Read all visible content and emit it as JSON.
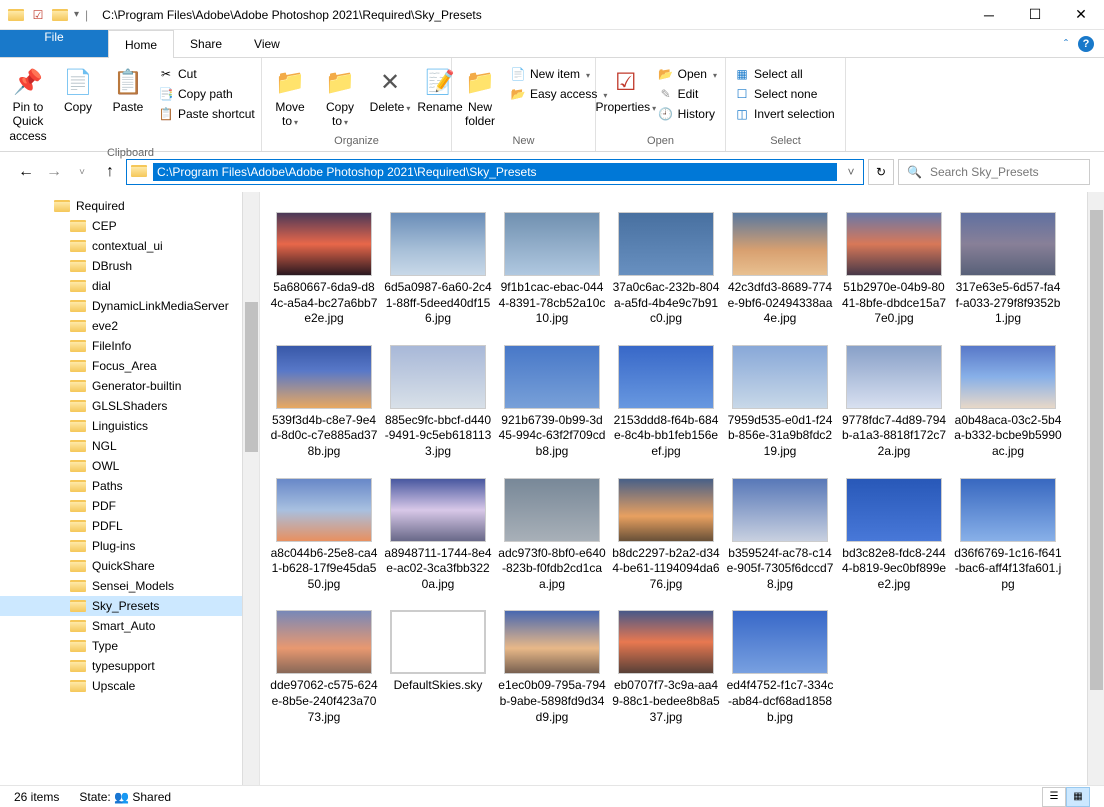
{
  "title": "C:\\Program Files\\Adobe\\Adobe Photoshop 2021\\Required\\Sky_Presets",
  "address_path": "C:\\Program Files\\Adobe\\Adobe Photoshop 2021\\Required\\Sky_Presets",
  "search_placeholder": "Search Sky_Presets",
  "tabs": {
    "file": "File",
    "home": "Home",
    "share": "Share",
    "view": "View"
  },
  "ribbon": {
    "pin": "Pin to Quick access",
    "copy": "Copy",
    "paste": "Paste",
    "cut": "Cut",
    "copypath": "Copy path",
    "pasteshortcut": "Paste shortcut",
    "clipboard": "Clipboard",
    "moveto": "Move to",
    "copyto": "Copy to",
    "delete": "Delete",
    "rename": "Rename",
    "organize": "Organize",
    "newfolder": "New folder",
    "newitem": "New item",
    "easyaccess": "Easy access",
    "new": "New",
    "properties": "Properties",
    "open": "Open",
    "edit": "Edit",
    "history": "History",
    "open_group": "Open",
    "selectall": "Select all",
    "selectnone": "Select none",
    "invert": "Invert selection",
    "select": "Select"
  },
  "tree": {
    "root": "Required",
    "items": [
      "CEP",
      "contextual_ui",
      "DBrush",
      "dial",
      "DynamicLinkMediaServer",
      "eve2",
      "FileInfo",
      "Focus_Area",
      "Generator-builtin",
      "GLSLShaders",
      "Linguistics",
      "NGL",
      "OWL",
      "Paths",
      "PDF",
      "PDFL",
      "Plug-ins",
      "QuickShare",
      "Sensei_Models",
      "Sky_Presets",
      "Smart_Auto",
      "Type",
      "typesupport",
      "Upscale"
    ],
    "selected": "Sky_Presets"
  },
  "files": [
    {
      "n": "5a680667-6da9-d84c-a5a4-bc27a6bb7e2e.jpg",
      "c": "sky1"
    },
    {
      "n": "6d5a0987-6a60-2c41-88ff-5deed40df156.jpg",
      "c": "sky2"
    },
    {
      "n": "9f1b1cac-ebac-0444-8391-78cb52a10c10.jpg",
      "c": "sky3"
    },
    {
      "n": "37a0c6ac-232b-804a-a5fd-4b4e9c7b91c0.jpg",
      "c": "sky4"
    },
    {
      "n": "42c3dfd3-8689-774e-9bf6-02494338aa4e.jpg",
      "c": "sky5"
    },
    {
      "n": "51b2970e-04b9-8041-8bfe-dbdce15a77e0.jpg",
      "c": "sky6"
    },
    {
      "n": "317e63e5-6d57-fa4f-a033-279f8f9352b1.jpg",
      "c": "sky7"
    },
    {
      "n": "539f3d4b-c8e7-9e4d-8d0c-c7e885ad378b.jpg",
      "c": "sky8"
    },
    {
      "n": "885ec9fc-bbcf-d440-9491-9c5eb6181133.jpg",
      "c": "sky9"
    },
    {
      "n": "921b6739-0b99-3d45-994c-63f2f709cdb8.jpg",
      "c": "sky10"
    },
    {
      "n": "2153ddd8-f64b-684e-8c4b-bb1feb156eef.jpg",
      "c": "sky11"
    },
    {
      "n": "7959d535-e0d1-f24b-856e-31a9b8fdc219.jpg",
      "c": "sky12"
    },
    {
      "n": "9778fdc7-4d89-794b-a1a3-8818f172c72a.jpg",
      "c": "sky13"
    },
    {
      "n": "a0b48aca-03c2-5b4a-b332-bcbe9b5990ac.jpg",
      "c": "sky14"
    },
    {
      "n": "a8c044b6-25e8-ca41-b628-17f9e45da550.jpg",
      "c": "sky15"
    },
    {
      "n": "a8948711-1744-8e4e-ac02-3ca3fbb3220a.jpg",
      "c": "sky16"
    },
    {
      "n": "adc973f0-8bf0-e640-823b-f0fdb2cd1caa.jpg",
      "c": "sky17"
    },
    {
      "n": "b8dc2297-b2a2-d344-be61-1194094da676.jpg",
      "c": "sky18"
    },
    {
      "n": "b359524f-ac78-c14e-905f-7305f6dccd78.jpg",
      "c": "sky19"
    },
    {
      "n": "bd3c82e8-fdc8-2444-b819-9ec0bf899ee2.jpg",
      "c": "sky20"
    },
    {
      "n": "d36f6769-1c16-f641-bac6-aff4f13fa601.jpg",
      "c": "sky21"
    },
    {
      "n": "dde97062-c575-624e-8b5e-240f423a7073.jpg",
      "c": "sky22"
    },
    {
      "n": "DefaultSkies.sky",
      "c": "sky23"
    },
    {
      "n": "e1ec0b09-795a-794b-9abe-5898fd9d34d9.jpg",
      "c": "sky24"
    },
    {
      "n": "eb0707f7-3c9a-aa49-88c1-bedee8b8a537.jpg",
      "c": "sky25"
    },
    {
      "n": "ed4f4752-f1c7-334c-ab84-dcf68ad1858b.jpg",
      "c": "sky26"
    }
  ],
  "status": {
    "count": "26 items",
    "state_label": "State:",
    "state_value": "Shared"
  }
}
